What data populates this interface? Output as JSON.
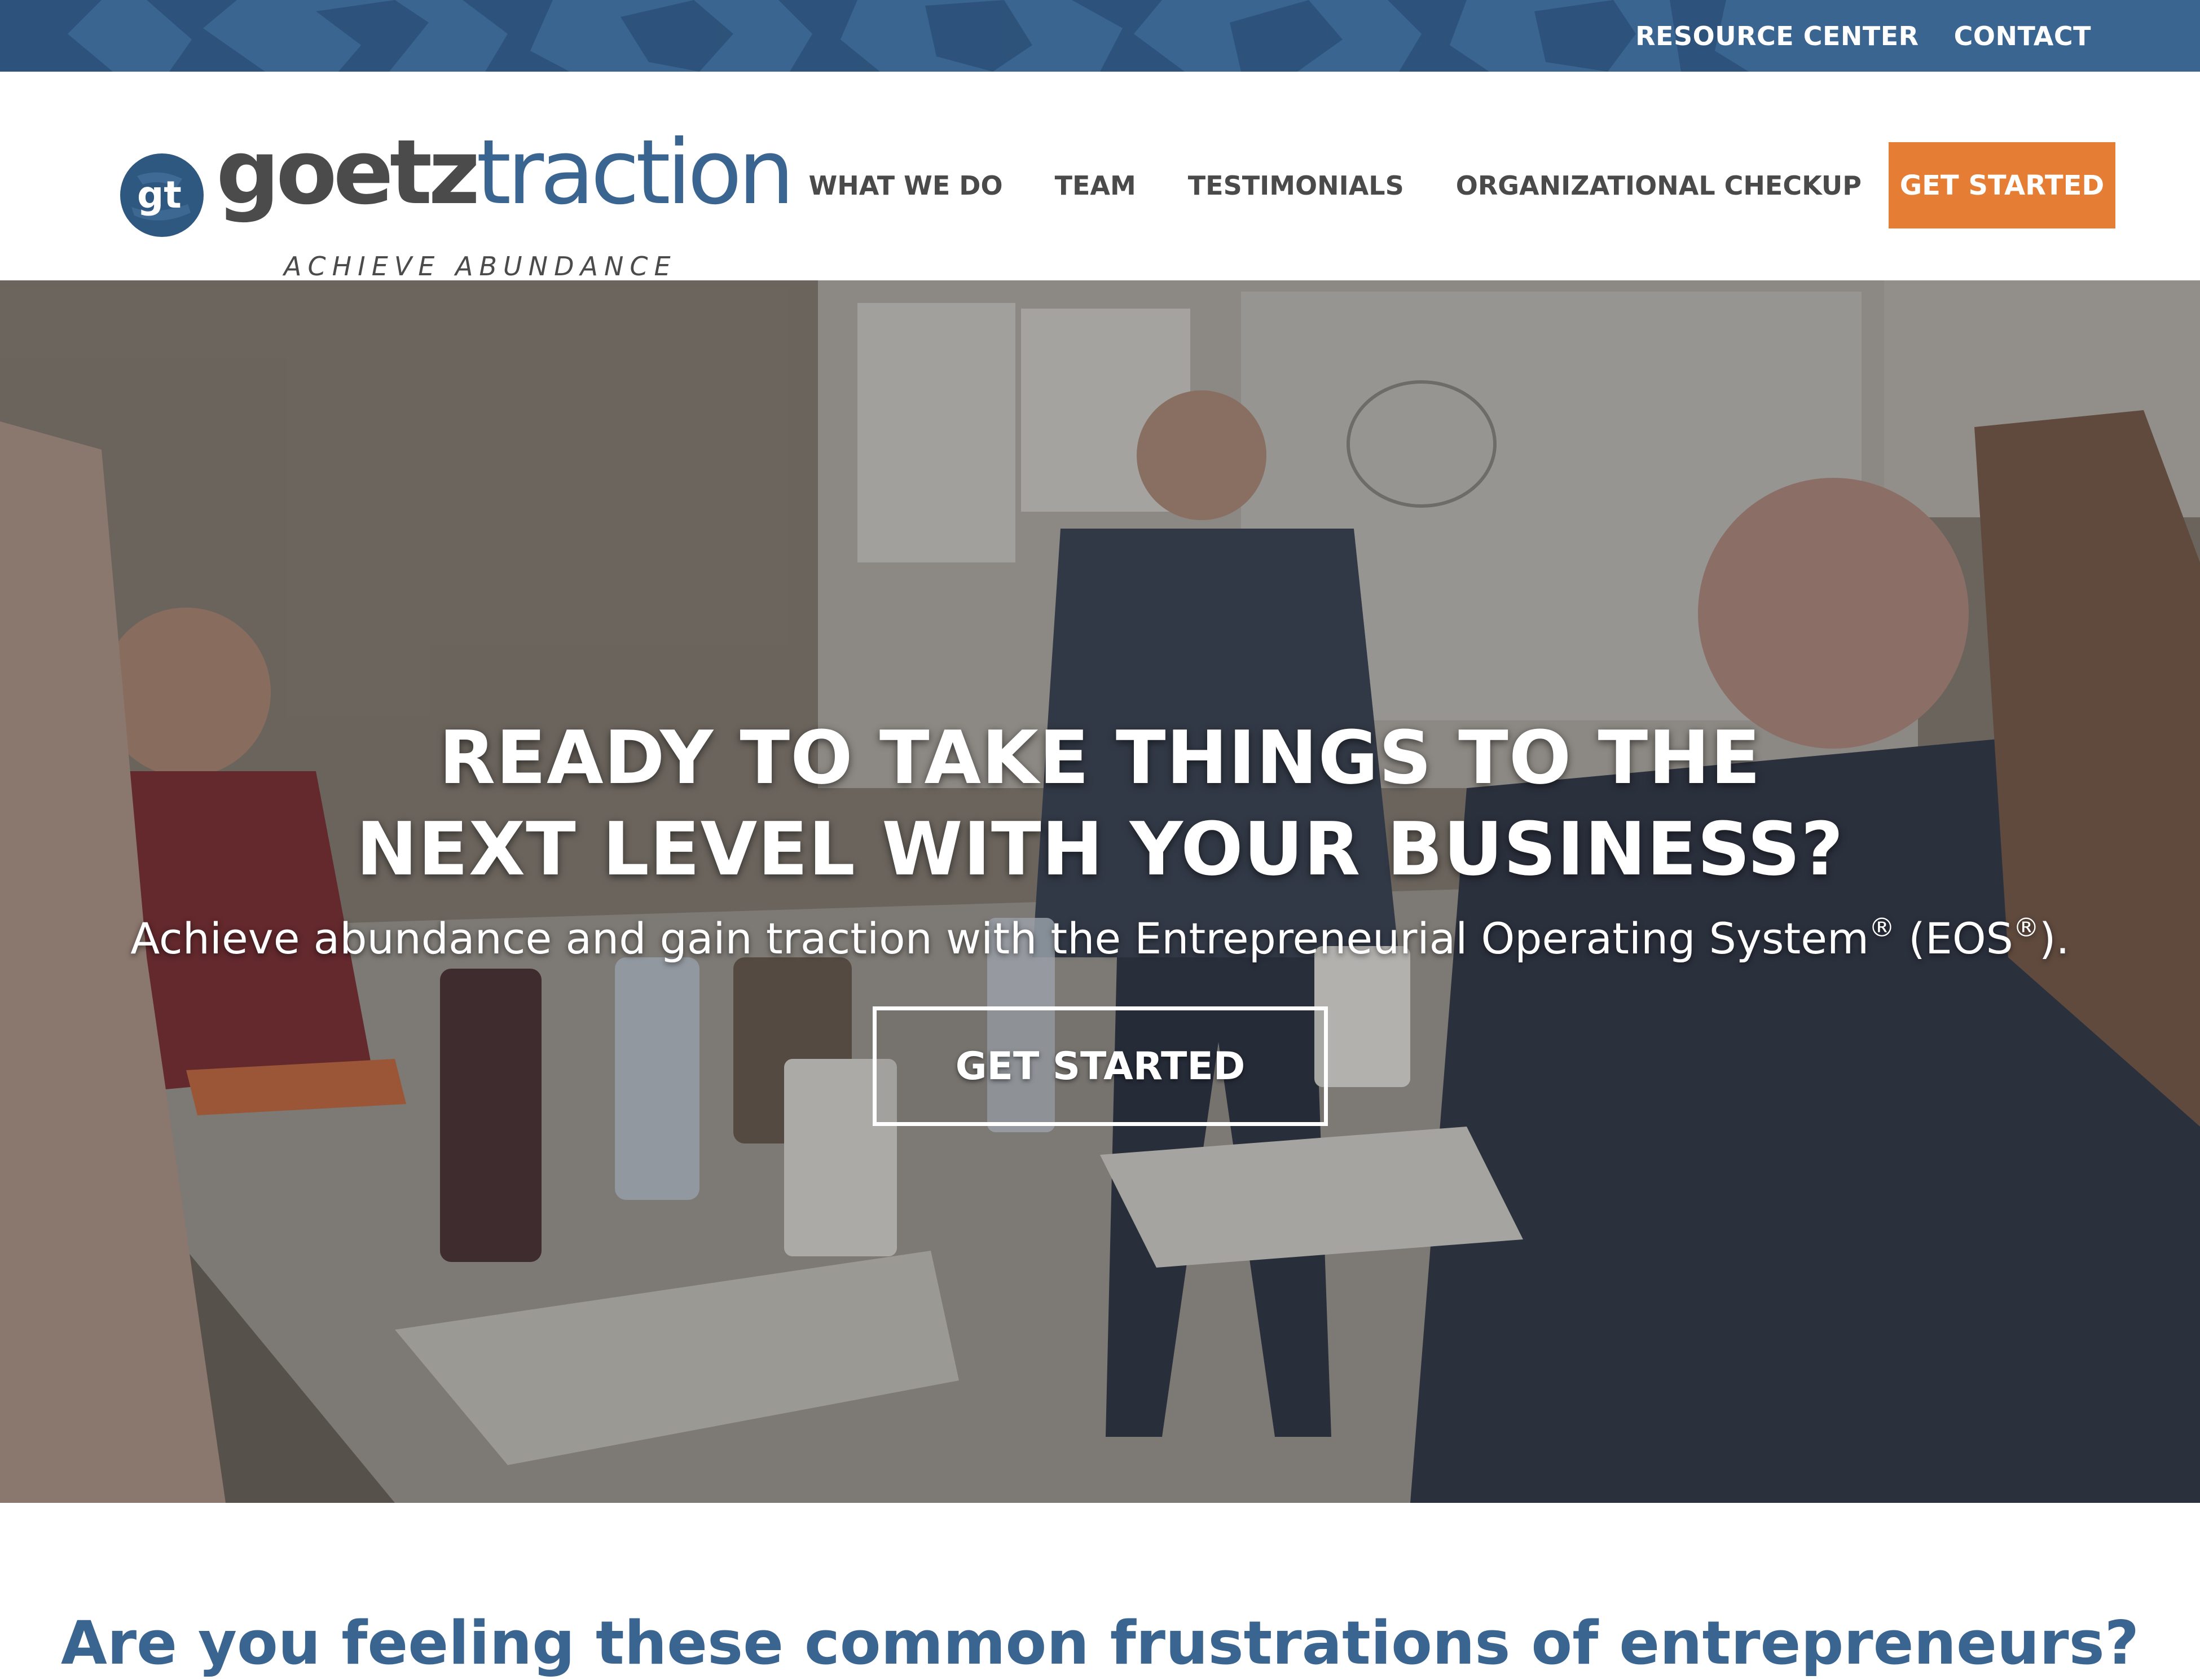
{
  "colors": {
    "brand_blue": "#3b6591",
    "brand_orange": "#e57d34",
    "nav_text": "#4a4a4a",
    "white": "#ffffff"
  },
  "utility_nav": {
    "items": [
      {
        "label": "RESOURCE CENTER"
      },
      {
        "label": "CONTACT"
      }
    ]
  },
  "logo": {
    "icon": "gt-monogram-icon",
    "word_part1": "goetz",
    "word_part2": "traction",
    "tagline": "ACHIEVE ABUNDANCE"
  },
  "main_nav": {
    "items": [
      {
        "label": "WHAT WE DO"
      },
      {
        "label": "TEAM"
      },
      {
        "label": "TESTIMONIALS"
      },
      {
        "label": "ORGANIZATIONAL CHECKUP"
      }
    ],
    "cta_label": "GET STARTED"
  },
  "hero": {
    "title_line1": "READY TO TAKE THINGS TO THE",
    "title_line2": "NEXT LEVEL WITH YOUR BUSINESS?",
    "subtitle_main": "Achieve abundance and gain traction with the Entrepreneurial Operating System",
    "subtitle_reg1": "®",
    "subtitle_mid": " (EOS",
    "subtitle_reg2": "®",
    "subtitle_end": ").",
    "cta_label": "GET STARTED",
    "background": "meeting-room-photo"
  },
  "section": {
    "heading": "Are you feeling these common frustrations of entrepreneurs?"
  }
}
